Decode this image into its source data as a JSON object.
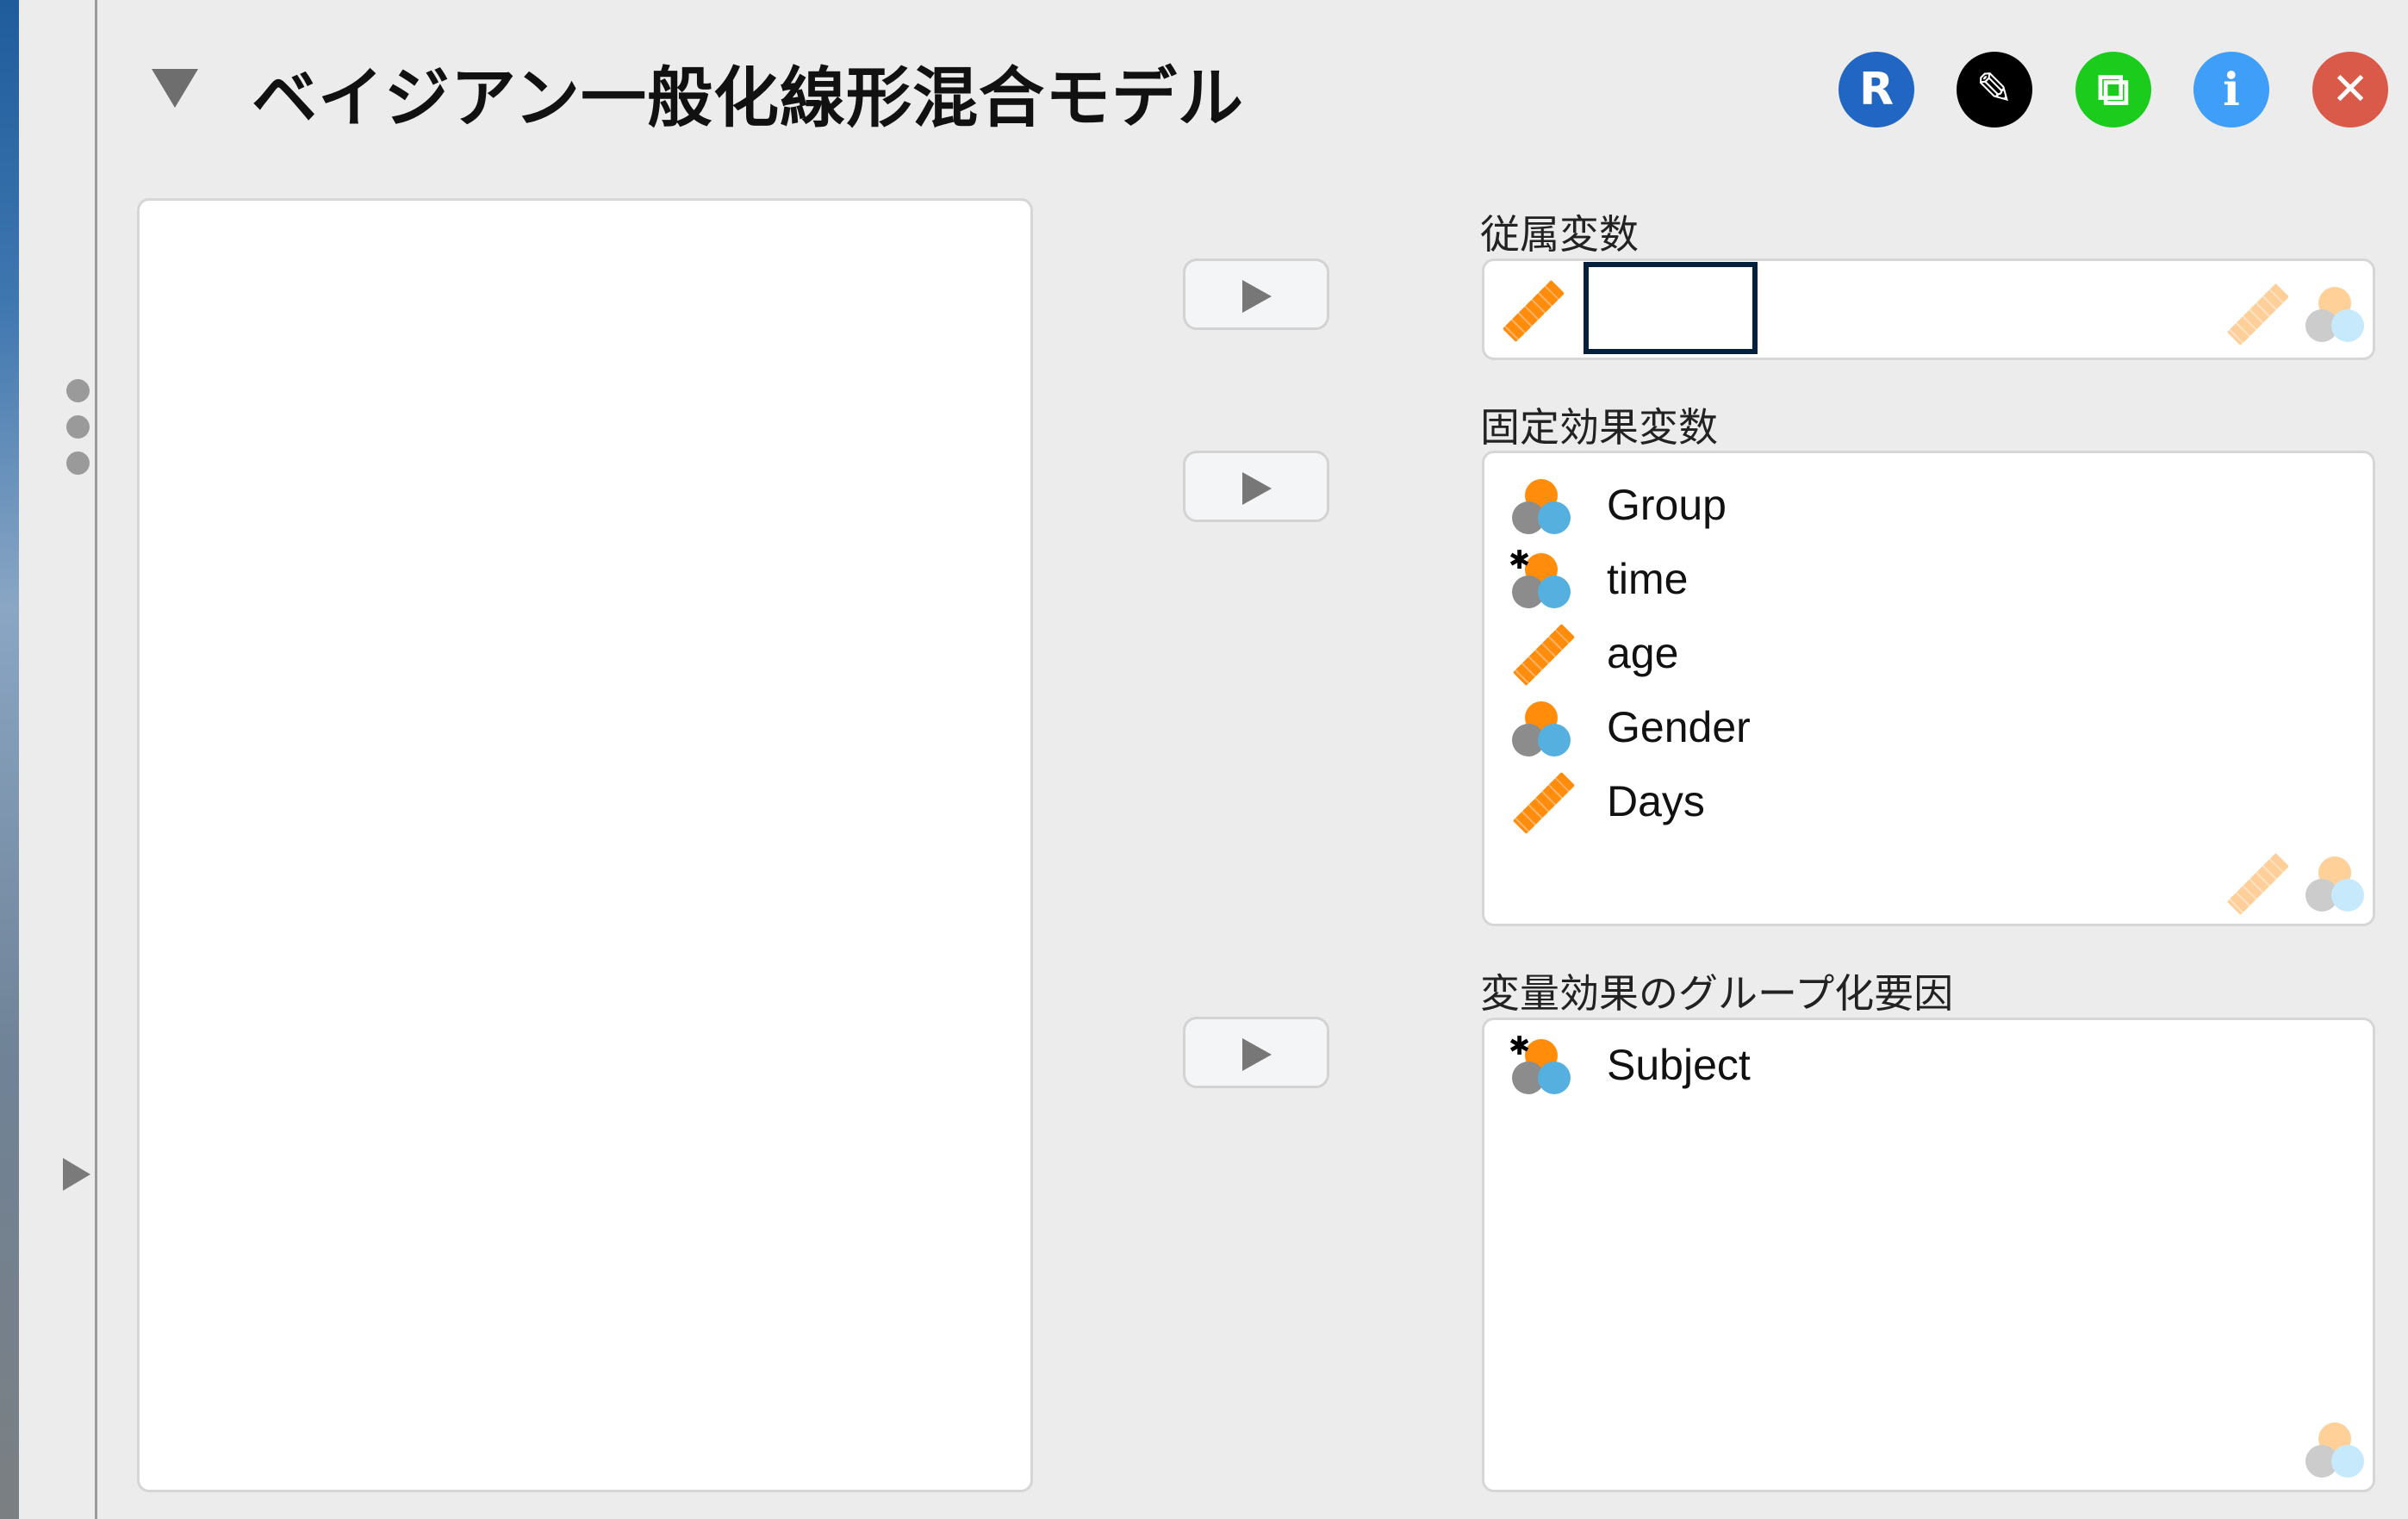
{
  "header": {
    "title": "ベイジアン一般化線形混合モデル",
    "buttons": [
      {
        "name": "r-syntax-button",
        "icon": "R",
        "color": "#2266c4"
      },
      {
        "name": "edit-button",
        "icon": "✎",
        "color": "#000000"
      },
      {
        "name": "duplicate-button",
        "icon": "⧉",
        "color": "#1ccc1c"
      },
      {
        "name": "info-button",
        "icon": "i",
        "color": "#3f9ef8"
      },
      {
        "name": "close-button",
        "icon": "✕",
        "color": "#d95a48"
      }
    ]
  },
  "sidebar": {
    "menu_icon": "vertical-dots-icon",
    "expand_icon": "triangle-right-icon"
  },
  "available_variables": [],
  "dependent": {
    "label": "従属変数",
    "items": [],
    "allowed_types": [
      "scale",
      "nominal"
    ]
  },
  "fixed_effects": {
    "label": "固定効果変数",
    "items": [
      {
        "name": "Group",
        "type": "nominal"
      },
      {
        "name": "time",
        "type": "nominal-text"
      },
      {
        "name": "age",
        "type": "scale"
      },
      {
        "name": "Gender",
        "type": "nominal"
      },
      {
        "name": "Days",
        "type": "scale"
      }
    ],
    "allowed_types": [
      "scale",
      "nominal"
    ]
  },
  "random_grouping": {
    "label": "変量効果のグループ化要因",
    "items": [
      {
        "name": "Subject",
        "type": "nominal-text"
      }
    ],
    "allowed_types": [
      "nominal"
    ]
  },
  "colors": {
    "background": "#ececec",
    "scale_icon": "#ff8c0a",
    "nominal_gray": "#8c8c8c",
    "nominal_blue": "#55b0e0"
  }
}
